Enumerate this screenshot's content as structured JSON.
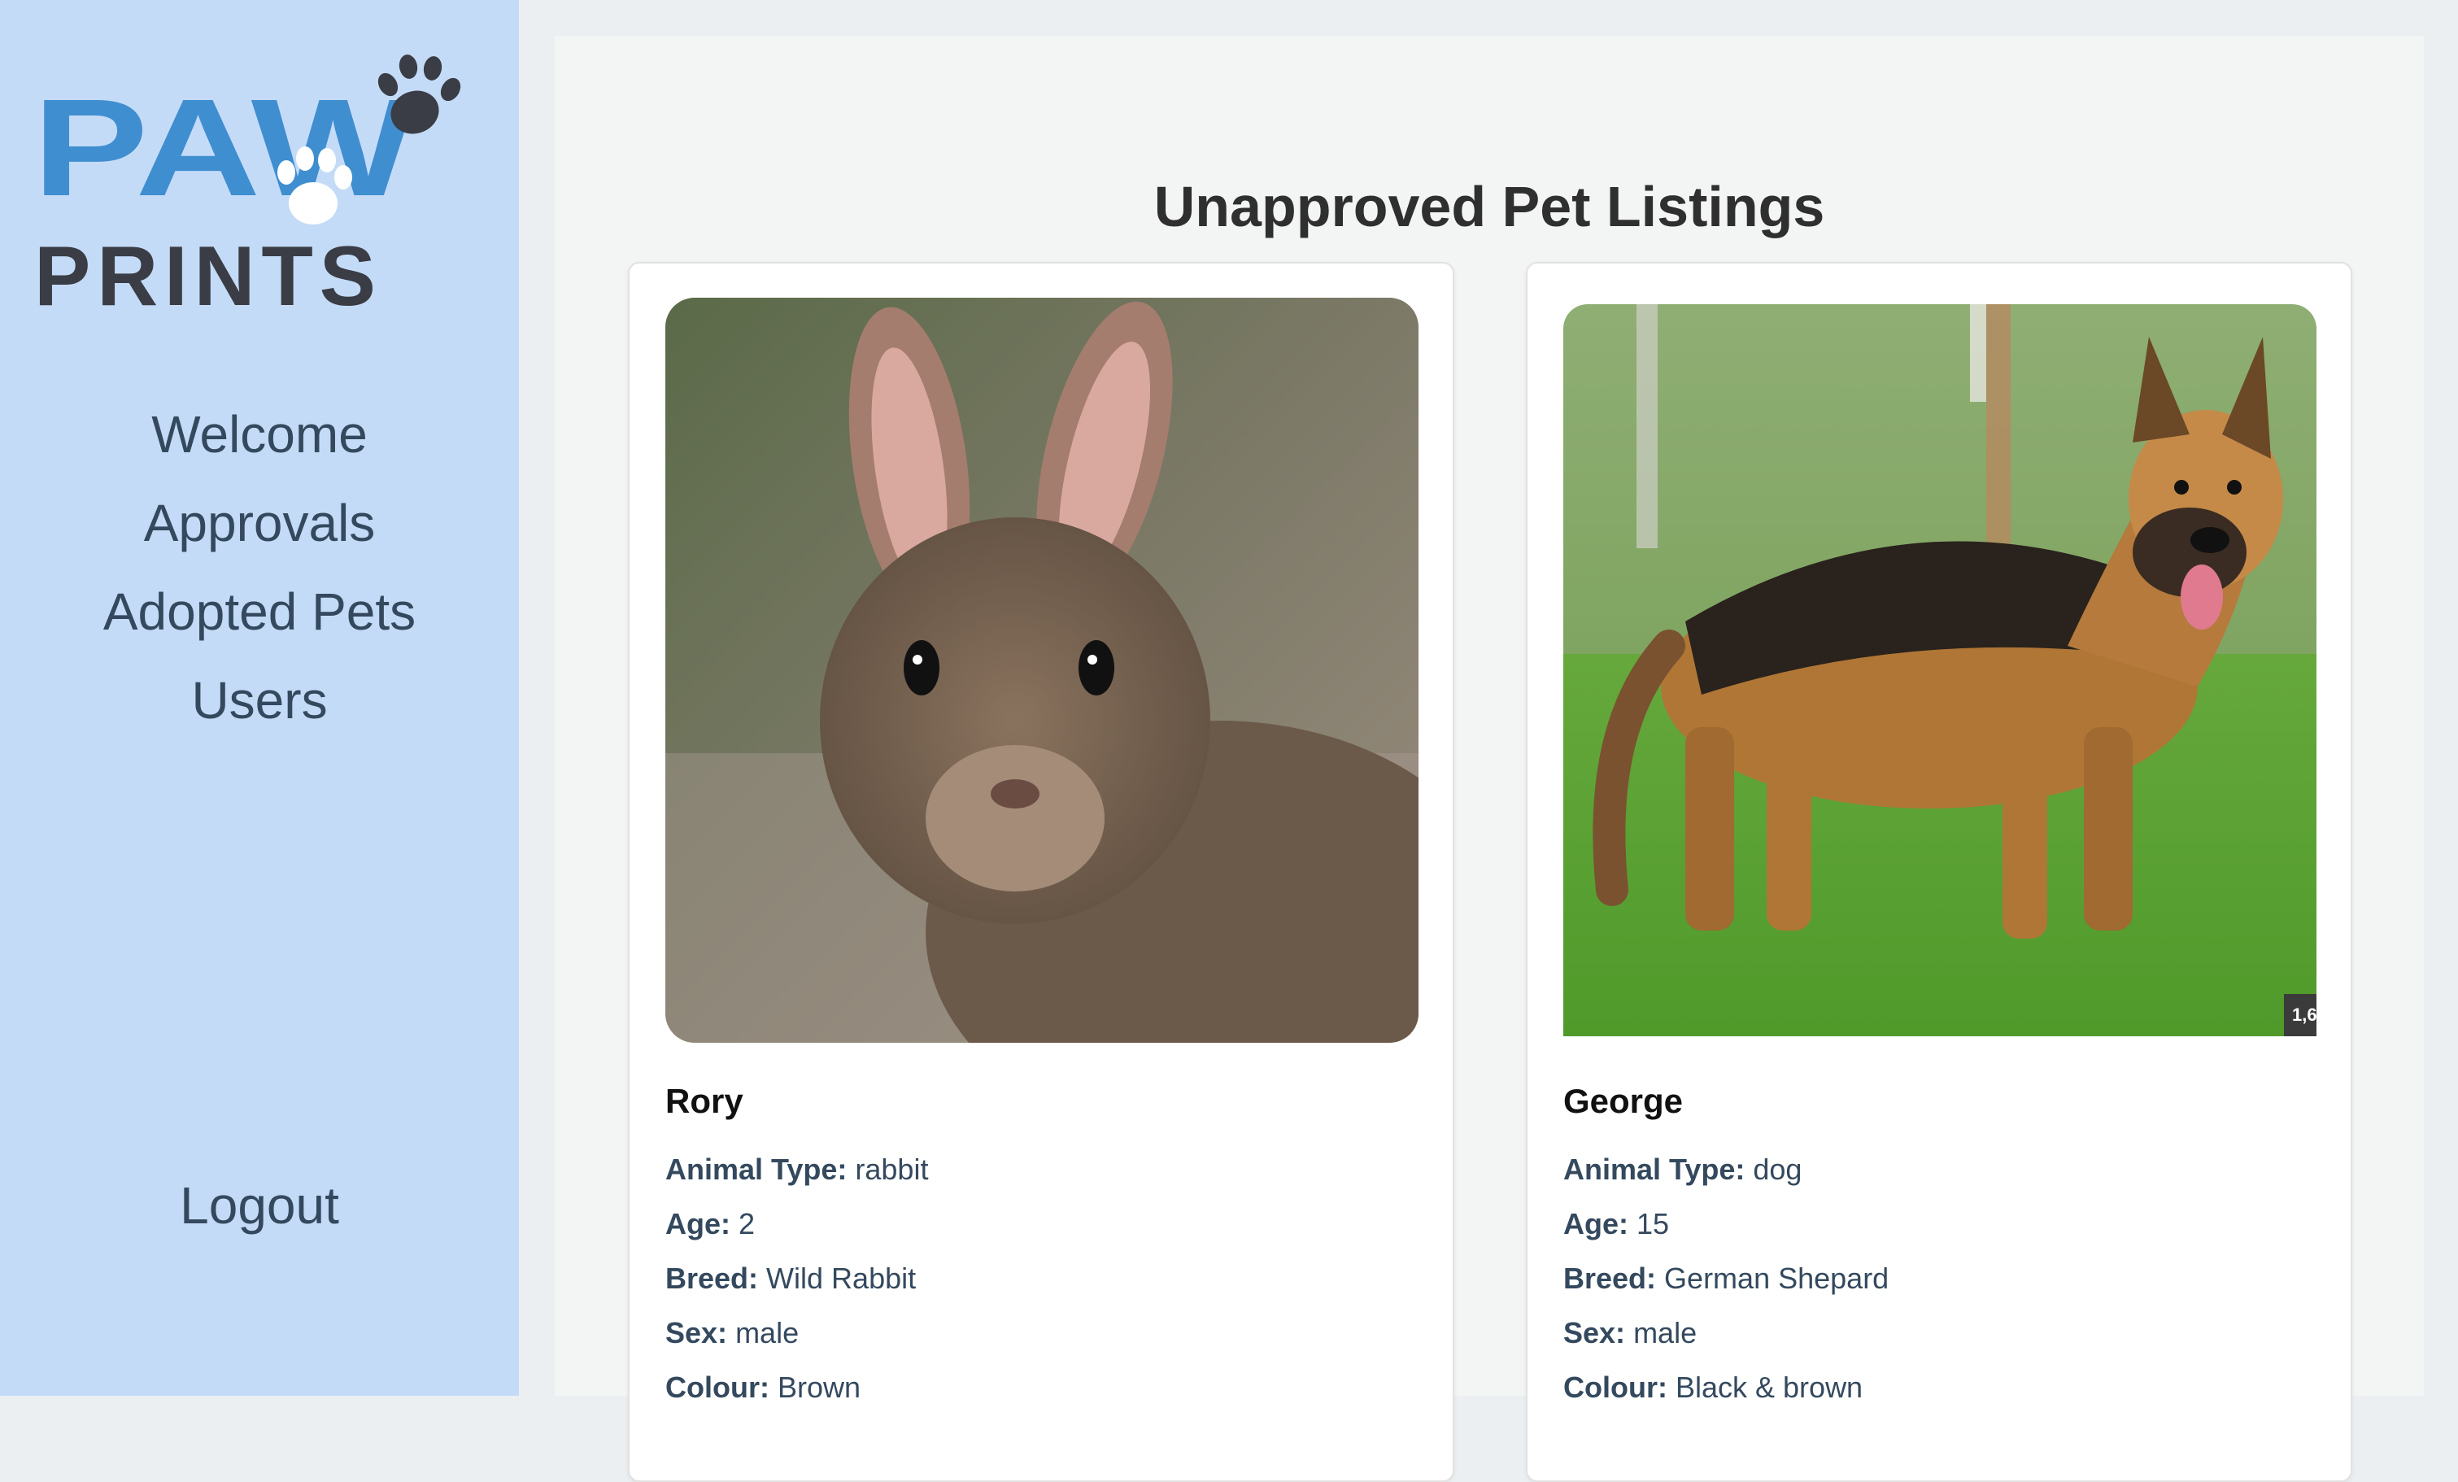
{
  "sidebar": {
    "logo": {
      "line1": "PAW",
      "line2": "PRINTS",
      "brand_blue": "#3f8ed0",
      "brand_dark": "#3a3d45"
    },
    "nav": [
      {
        "label": "Welcome"
      },
      {
        "label": "Approvals"
      },
      {
        "label": "Adopted Pets"
      },
      {
        "label": "Users"
      }
    ],
    "logout_label": "Logout",
    "background": "#c4dbf7"
  },
  "main": {
    "title": "Unapproved Pet Listings",
    "pets": [
      {
        "name": "Rory",
        "photo_subject": "rabbit",
        "fields": [
          {
            "label": "Animal Type:",
            "value": "rabbit"
          },
          {
            "label": "Age:",
            "value": "2"
          },
          {
            "label": "Breed:",
            "value": "Wild Rabbit"
          },
          {
            "label": "Sex:",
            "value": "male"
          },
          {
            "label": "Colour:",
            "value": "Brown"
          }
        ]
      },
      {
        "name": "George",
        "photo_subject": "german-shepherd",
        "photo_badge": "1,6",
        "fields": [
          {
            "label": "Animal Type:",
            "value": "dog"
          },
          {
            "label": "Age:",
            "value": "15"
          },
          {
            "label": "Breed:",
            "value": "German Shepard"
          },
          {
            "label": "Sex:",
            "value": "male"
          },
          {
            "label": "Colour:",
            "value": "Black & brown"
          }
        ]
      }
    ]
  }
}
